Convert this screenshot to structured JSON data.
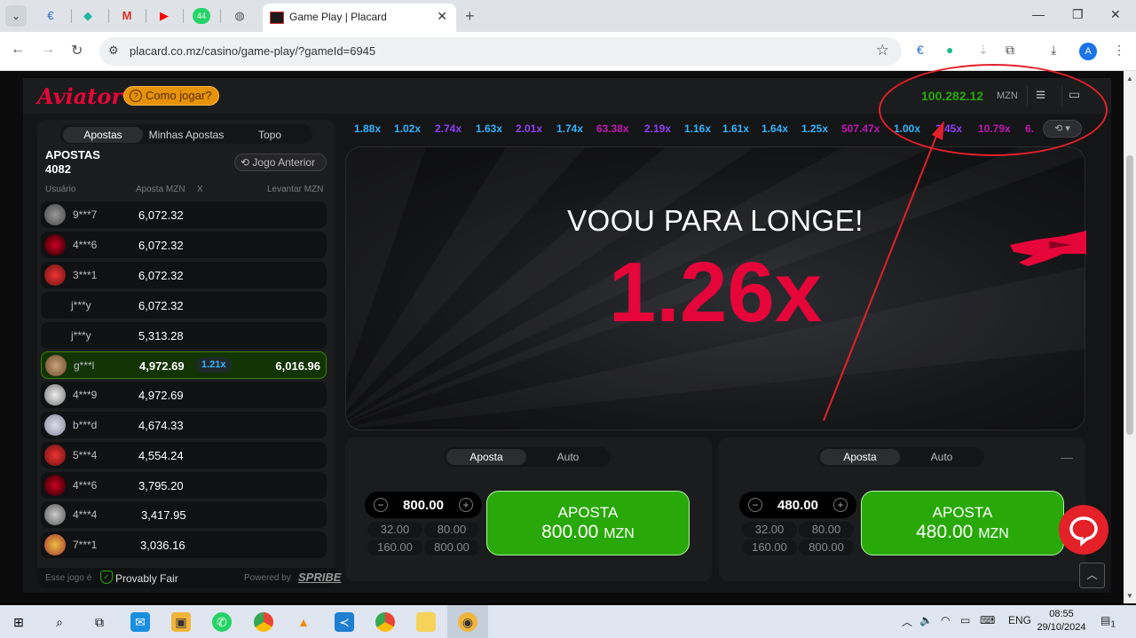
{
  "browser": {
    "active_tab_title": "Game Play | Placard",
    "url": "placard.co.mz/casino/game-play/?gameId=6945",
    "whatsapp_badge": "44",
    "profile_initial": "A"
  },
  "header": {
    "logo": "Aviator",
    "how_to": "Como jogar?",
    "balance": "100.282.12",
    "currency": "MZN"
  },
  "bets_panel": {
    "tabs": [
      "Apostas",
      "Minhas Apostas",
      "Topo"
    ],
    "title": "APOSTAS",
    "count": "4082",
    "prev_game": "Jogo Anterior",
    "col_user": "Usuário",
    "col_bet": "Aposta MZN",
    "col_x": "X",
    "col_cashout": "Levantar MZN",
    "rows": [
      {
        "user": "9***7",
        "amount": "6,072.32"
      },
      {
        "user": "4***6",
        "amount": "6,072.32"
      },
      {
        "user": "3***1",
        "amount": "6,072.32"
      },
      {
        "user": "j***y",
        "amount": "6,072.32"
      },
      {
        "user": "j***y",
        "amount": "5,313.28"
      },
      {
        "user": "g***l",
        "amount": "4,972.69",
        "mult": "1.21x",
        "cashout": "6,016.96"
      },
      {
        "user": "4***9",
        "amount": "4,972.69"
      },
      {
        "user": "b***d",
        "amount": "4,674.33"
      },
      {
        "user": "5***4",
        "amount": "4,554.24"
      },
      {
        "user": "4***6",
        "amount": "3,795.20"
      },
      {
        "user": "4***4",
        "amount": "3,417.95"
      },
      {
        "user": "7***1",
        "amount": "3,036.16"
      }
    ],
    "footer_game": "Esse jogo é",
    "footer_fair": "Provably Fair",
    "footer_powered": "Powered by",
    "footer_brand": "SPRIBE"
  },
  "history": [
    "1.88x",
    "1.02x",
    "2.74x",
    "1.63x",
    "2.01x",
    "1.74x",
    "63.38x",
    "2.19x",
    "1.16x",
    "1.61x",
    "1.64x",
    "1.25x",
    "507.47x",
    "1.00x",
    "2.45x",
    "10.79x",
    "6."
  ],
  "colors": {
    "blue": "#34b4ff",
    "purple": "#913ef8",
    "pink": "#c017b4",
    "green": "#28a909",
    "red": "#e50539"
  },
  "play": {
    "status": "VOOU PARA LONGE!",
    "multiplier": "1.26x"
  },
  "bet1": {
    "tabs": [
      "Aposta",
      "Auto"
    ],
    "amount": "800.00",
    "chips": [
      "32.00",
      "80.00",
      "160.00",
      "800.00"
    ],
    "button_label": "APOSTA",
    "button_amount": "800.00",
    "button_currency": "MZN"
  },
  "bet2": {
    "tabs": [
      "Aposta",
      "Auto"
    ],
    "amount": "480.00",
    "chips": [
      "32.00",
      "80.00",
      "160.00",
      "800.00"
    ],
    "button_label": "APOSTA",
    "button_amount": "480.00",
    "button_currency": "MZN"
  },
  "taskbar": {
    "language": "ENG",
    "time": "08:55",
    "date": "29/10/2024",
    "notif_count": "1"
  }
}
